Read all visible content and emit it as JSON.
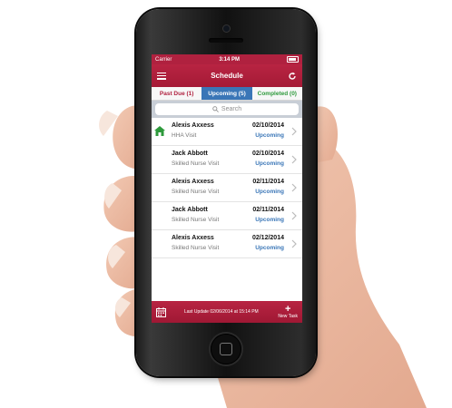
{
  "status_bar": {
    "carrier": "Carrier",
    "time": "3:14 PM"
  },
  "navbar": {
    "title": "Schedule"
  },
  "tabs": [
    {
      "label": "Past Due (1)"
    },
    {
      "label": "Upcoming (5)"
    },
    {
      "label": "Completed (0)"
    }
  ],
  "search": {
    "placeholder": "Search"
  },
  "visits": [
    {
      "name": "Alexis Axxess",
      "type": "HHA Visit",
      "date": "02/10/2014",
      "status": "Upcoming"
    },
    {
      "name": "Jack Abbott",
      "type": "Skilled Nurse Visit",
      "date": "02/10/2014",
      "status": "Upcoming"
    },
    {
      "name": "Alexis Axxess",
      "type": "Skilled Nurse Visit",
      "date": "02/11/2014",
      "status": "Upcoming"
    },
    {
      "name": "Jack Abbott",
      "type": "Skilled Nurse Visit",
      "date": "02/11/2014",
      "status": "Upcoming"
    },
    {
      "name": "Alexis Axxess",
      "type": "Skilled Nurse Visit",
      "date": "02/12/2014",
      "status": "Upcoming"
    }
  ],
  "footer": {
    "last_update": "Last Update 02/06/2014 at 15:14 PM",
    "new_task": "New Task"
  },
  "colors": {
    "brand": "#b0213f",
    "accent": "#3a76b7",
    "completed": "#2e9a3c"
  },
  "icons": [
    "menu-icon",
    "refresh-icon",
    "search-icon",
    "house-icon",
    "chevron-right-icon",
    "calendar-icon",
    "plus-icon"
  ]
}
